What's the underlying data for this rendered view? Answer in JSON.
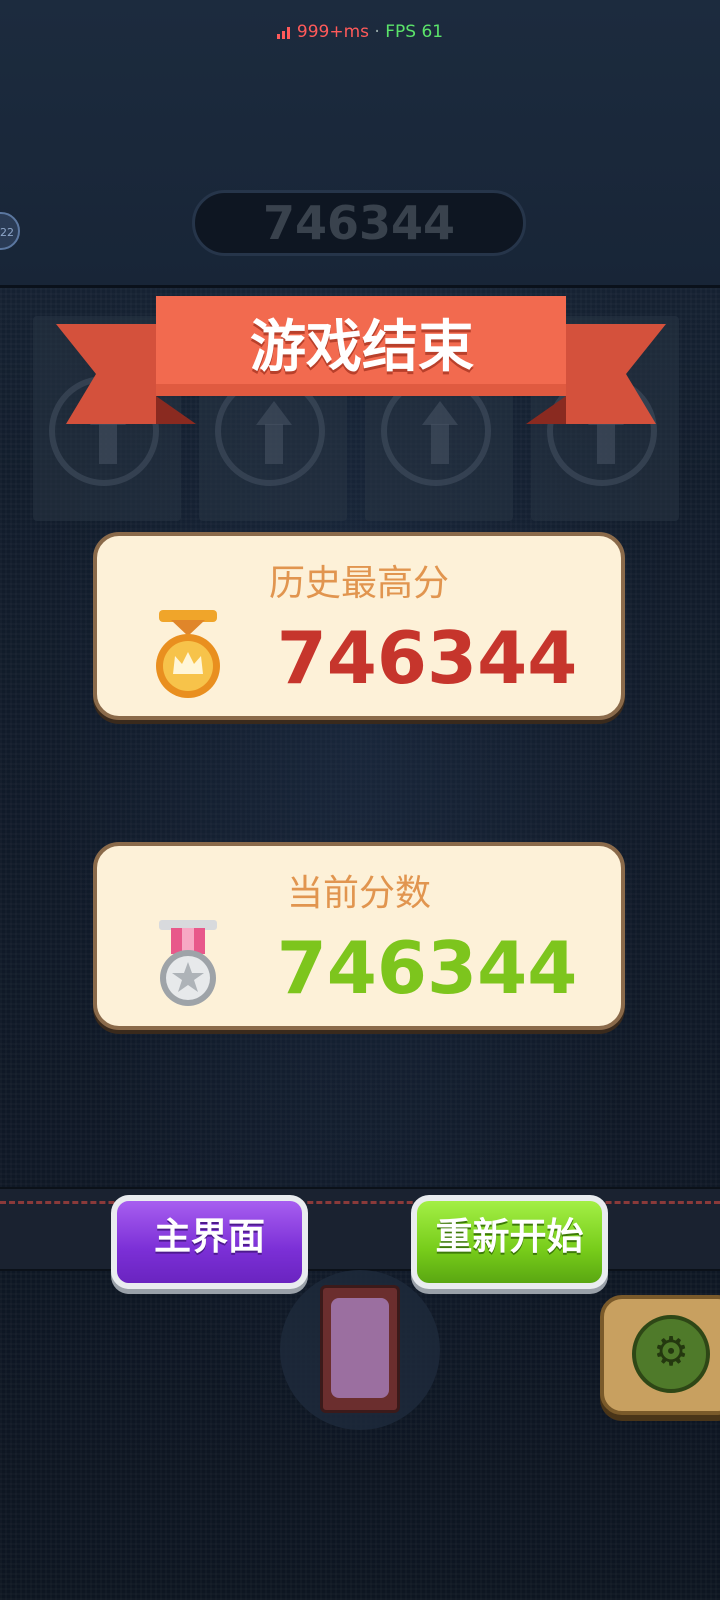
{
  "status": {
    "ping": "999+ms",
    "separator": "·",
    "fps": "FPS 61"
  },
  "level_badge": "22",
  "top_score": "746344",
  "banner": {
    "title": "游戏结束"
  },
  "best_score": {
    "label": "历史最高分",
    "value": "746344",
    "icon": "gold-crown-medal-icon",
    "color": "#c6352c"
  },
  "current_score": {
    "label": "当前分数",
    "value": "746344",
    "icon": "silver-star-medal-icon",
    "color": "#7dc51d"
  },
  "buttons": {
    "home": "主界面",
    "restart": "重新开始"
  },
  "colors": {
    "ribbon": "#f26a4f",
    "home_button": "#8a3fe0",
    "restart_button": "#84d323",
    "card_background": "#fdf1d8"
  },
  "icons": {
    "settings": "gear-icon",
    "item_card": "card-icon"
  }
}
